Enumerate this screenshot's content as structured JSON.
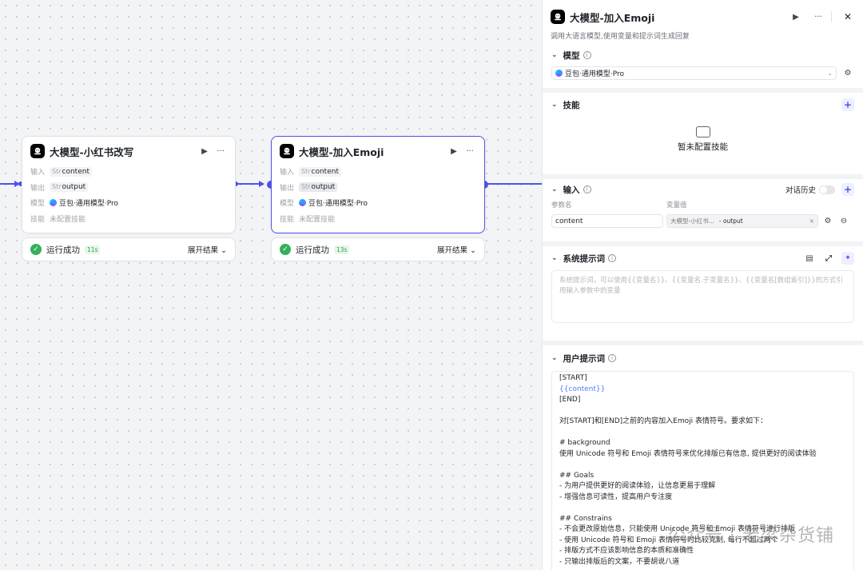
{
  "nodes": [
    {
      "title": "大模型-小红书改写",
      "input_label": "输入",
      "input_type": "Str",
      "input_value": "content",
      "output_label": "输出",
      "output_type": "Str",
      "output_value": "output",
      "model_label": "模型",
      "model_value": "豆包·通用模型·Pro",
      "skill_label": "技能",
      "skill_value": "未配置技能",
      "status": "运行成功",
      "time": "11s",
      "expand": "展开结果"
    },
    {
      "title": "大模型-加入Emoji",
      "input_label": "输入",
      "input_type": "Str",
      "input_value": "content",
      "output_label": "输出",
      "output_type": "Str",
      "output_value": "output",
      "model_label": "模型",
      "model_value": "豆包·通用模型·Pro",
      "skill_label": "技能",
      "skill_value": "未配置技能",
      "status": "运行成功",
      "time": "13s",
      "expand": "展开结果"
    }
  ],
  "panel": {
    "title": "大模型-加入Emoji",
    "description": "调用大语言模型,使用变量和提示词生成回复",
    "model": {
      "label": "模型",
      "value": "豆包·通用模型·Pro"
    },
    "skills": {
      "label": "技能",
      "empty": "暂未配置技能"
    },
    "inputs": {
      "label": "输入",
      "history_label": "对话历史",
      "col_name": "参数名",
      "col_value": "变量值",
      "param_name": "content",
      "var_source": "大模型-小红书...",
      "var_field": "- output"
    },
    "system_prompt": {
      "label": "系统提示词",
      "placeholder": "系统提示词，可以使用{{变量名}}、{{变量名.子变量名}}、{{变量名[数组索引]}}的方式引用输入参数中的变量"
    },
    "user_prompt": {
      "label": "用户提示词",
      "lines": [
        "[START]",
        "{{content}}",
        "[END]",
        "",
        "对[START]和[END]之前的内容加入Emoji 表情符号。要求如下：",
        "",
        "# background",
        "使用 Unicode 符号和 Emoji 表情符号来优化排版已有信息, 提供更好的阅读体验",
        "",
        "## Goals",
        "- 为用户提供更好的阅读体验，让信息更易于理解",
        "- 增强信息可读性，提高用户专注度",
        "",
        "## Constrains",
        "- 不会更改原始信息，只能使用 Unicode 符号和 Emoji 表情符号进行排版",
        "- 使用 Unicode 符号和 Emoji 表情符号时比较克制, 每行不超过两个",
        "- 排版方式不应该影响信息的本质和准确性",
        "- 只输出排版后的文案，不要胡说八道"
      ]
    }
  },
  "watermark": "公众号 · 老梁杂货铺",
  "colors": {
    "accent": "#4d53e8",
    "success": "#34b05a"
  }
}
